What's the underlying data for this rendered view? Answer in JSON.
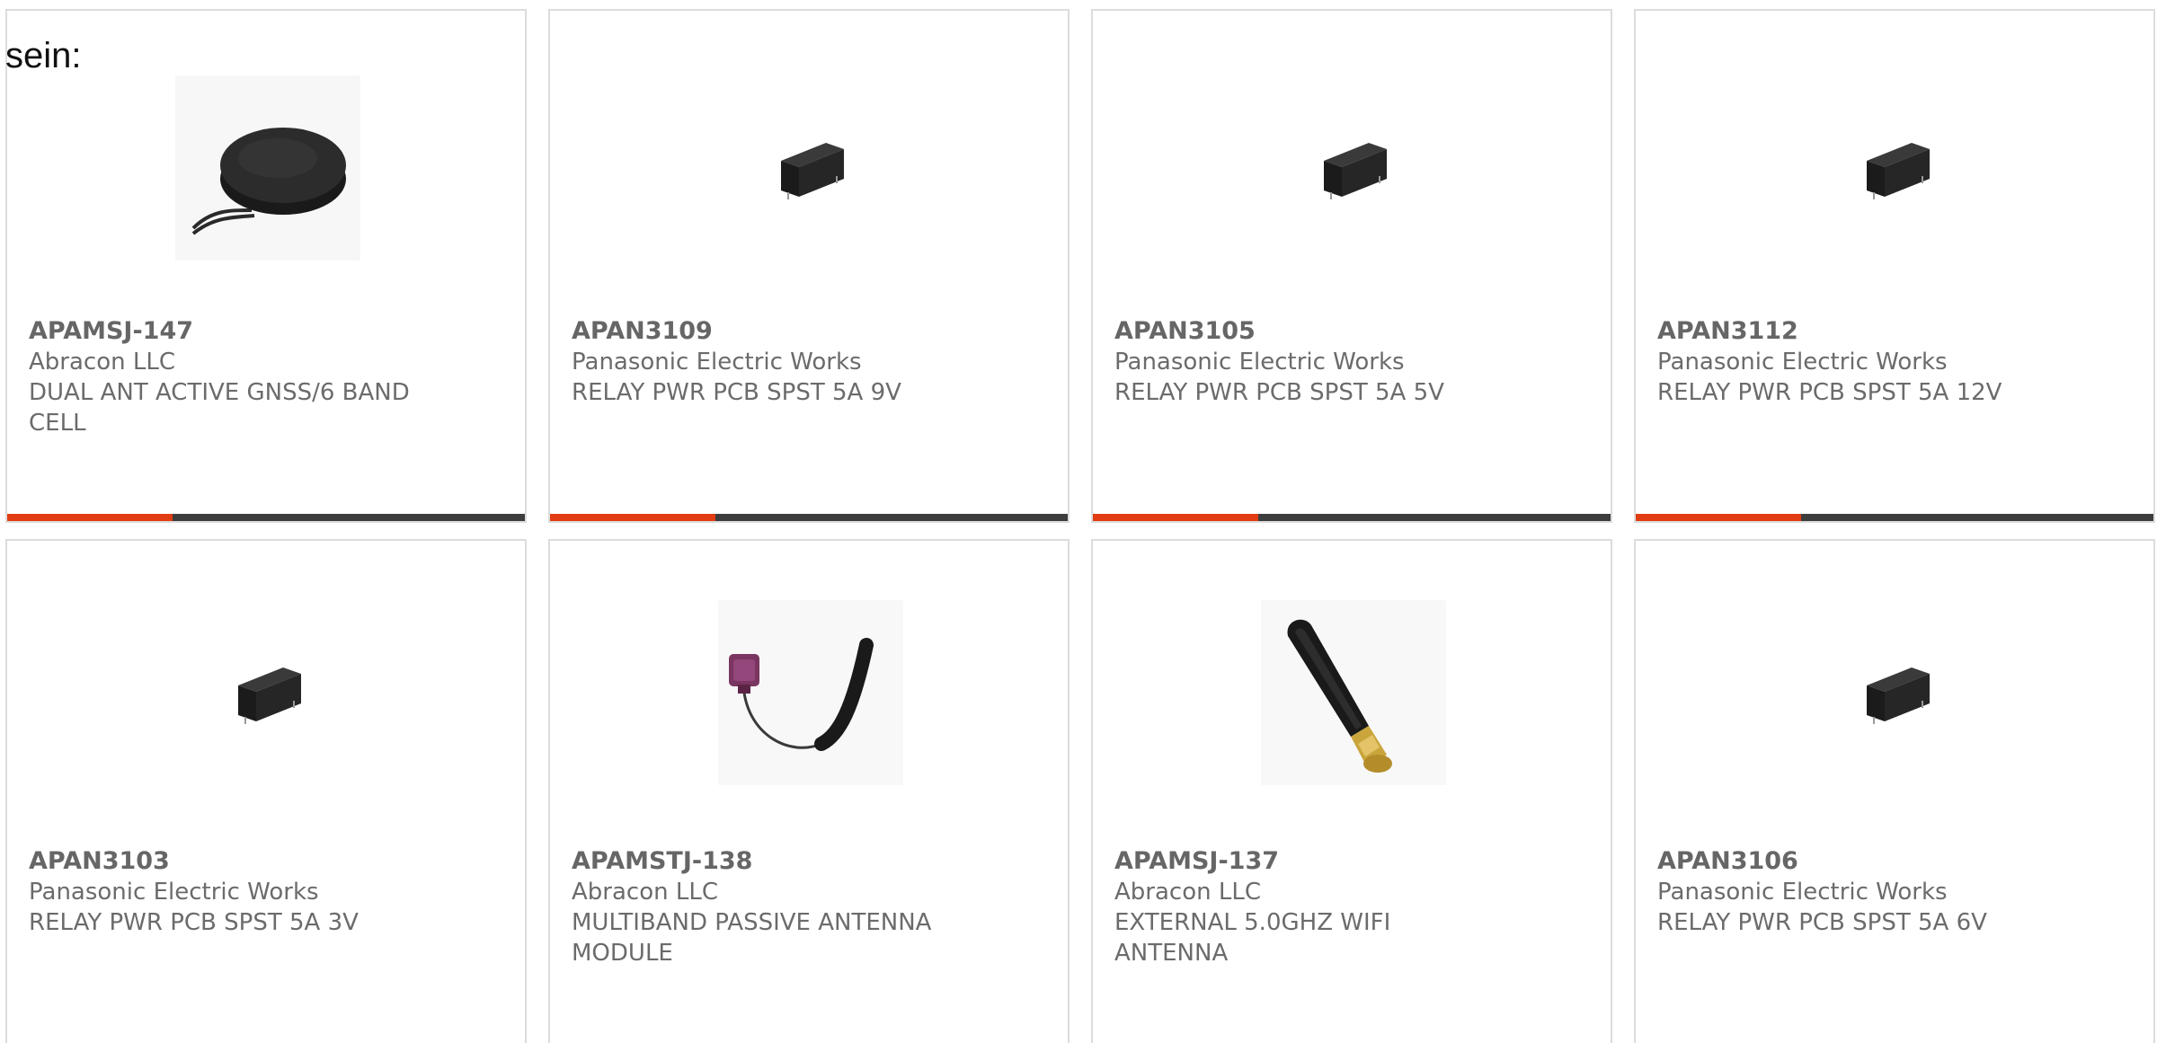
{
  "page": {
    "header_text": "sein:"
  },
  "accent_color": "#e23d12",
  "bar_color": "#3d3d3d",
  "products": [
    {
      "part_number": "APAMSJ-147",
      "manufacturer": "Abracon LLC",
      "description_line1": "DUAL ANT ACTIVE GNSS/6 BAND",
      "description_line2": "CELL",
      "image_icon": "puck-antenna-icon"
    },
    {
      "part_number": "APAN3109",
      "manufacturer": "Panasonic Electric Works",
      "description_line1": "RELAY PWR PCB SPST 5A 9V",
      "description_line2": "",
      "image_icon": "relay-icon"
    },
    {
      "part_number": "APAN3105",
      "manufacturer": "Panasonic Electric Works",
      "description_line1": "RELAY PWR PCB SPST 5A 5V",
      "description_line2": "",
      "image_icon": "relay-icon"
    },
    {
      "part_number": "APAN3112",
      "manufacturer": "Panasonic Electric Works",
      "description_line1": "RELAY PWR PCB SPST 5A 12V",
      "description_line2": "",
      "image_icon": "relay-icon"
    },
    {
      "part_number": "APAN3103",
      "manufacturer": "Panasonic Electric Works",
      "description_line1": "RELAY PWR PCB SPST 5A 3V",
      "description_line2": "",
      "image_icon": "relay-icon"
    },
    {
      "part_number": "APAMSTJ-138",
      "manufacturer": "Abracon LLC",
      "description_line1": "MULTIBAND PASSIVE ANTENNA",
      "description_line2": "MODULE",
      "image_icon": "flex-antenna-icon"
    },
    {
      "part_number": "APAMSJ-137",
      "manufacturer": "Abracon LLC",
      "description_line1": "EXTERNAL 5.0GHZ WIFI",
      "description_line2": "ANTENNA",
      "image_icon": "rubber-duck-antenna-icon"
    },
    {
      "part_number": "APAN3106",
      "manufacturer": "Panasonic Electric Works",
      "description_line1": "RELAY PWR PCB SPST 5A 6V",
      "description_line2": "",
      "image_icon": "relay-icon"
    }
  ]
}
